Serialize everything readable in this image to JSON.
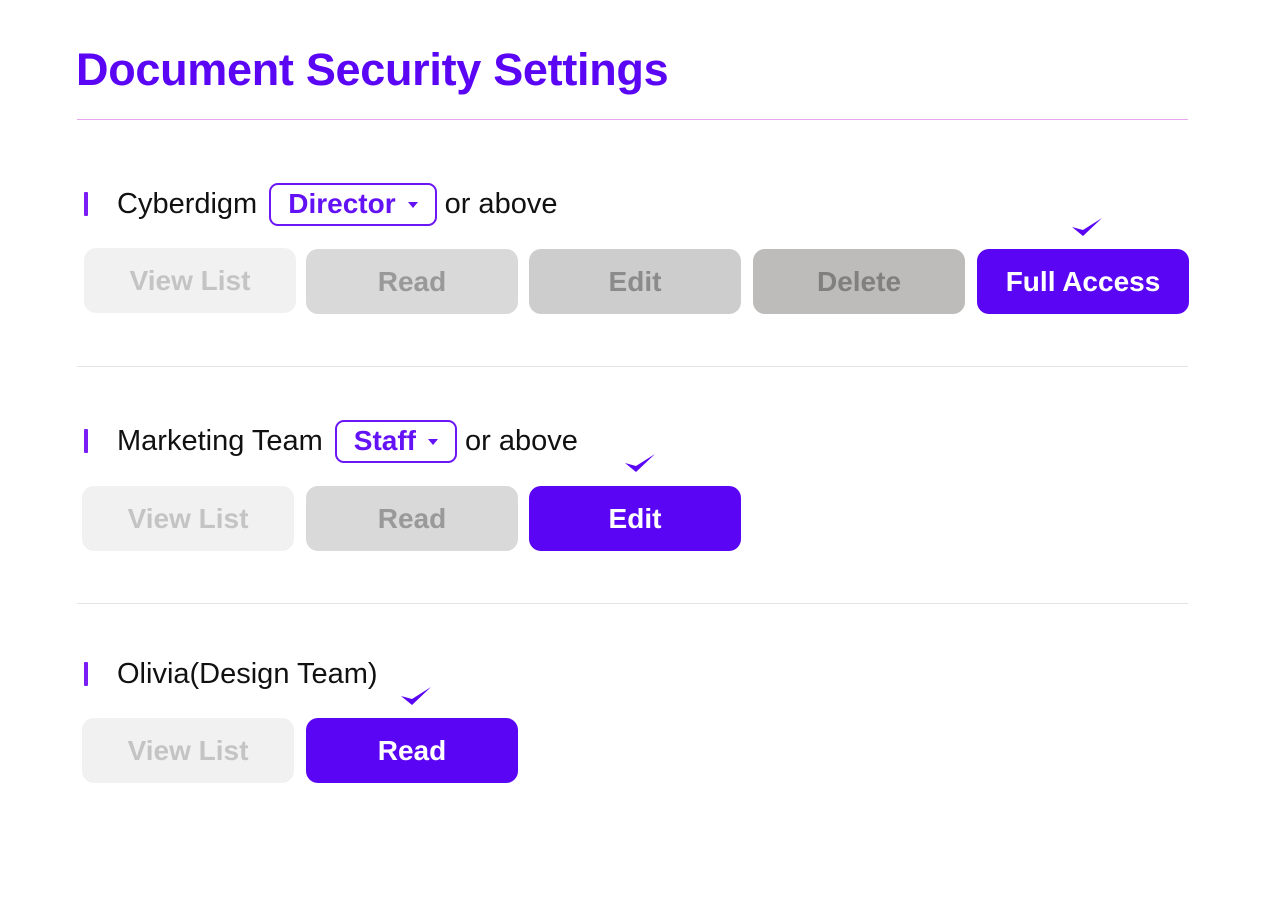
{
  "page": {
    "title": "Document Security Settings"
  },
  "colors": {
    "accent": "#5b05f5",
    "title_divider": "#e7a6ee",
    "inactive_level_1": "#f1f1f1",
    "inactive_level_2": "#d9d9d9",
    "inactive_level_3": "#cdcdcd",
    "inactive_level_4": "#bdbcbb"
  },
  "groups": [
    {
      "name": "Cyberdigm",
      "role": "Director",
      "suffix": "or above",
      "permissions": [
        "View List",
        "Read",
        "Edit",
        "Delete",
        "Full Access"
      ],
      "selected": "Full Access",
      "selected_icon": "checkmark-icon"
    },
    {
      "name": "Marketing Team",
      "role": "Staff",
      "suffix": "or above",
      "permissions": [
        "View List",
        "Read",
        "Edit"
      ],
      "selected": "Edit",
      "selected_icon": "checkmark-icon"
    },
    {
      "name": "Olivia(Design Team)",
      "permissions": [
        "View List",
        "Read"
      ],
      "selected": "Read",
      "selected_icon": "checkmark-icon"
    }
  ]
}
